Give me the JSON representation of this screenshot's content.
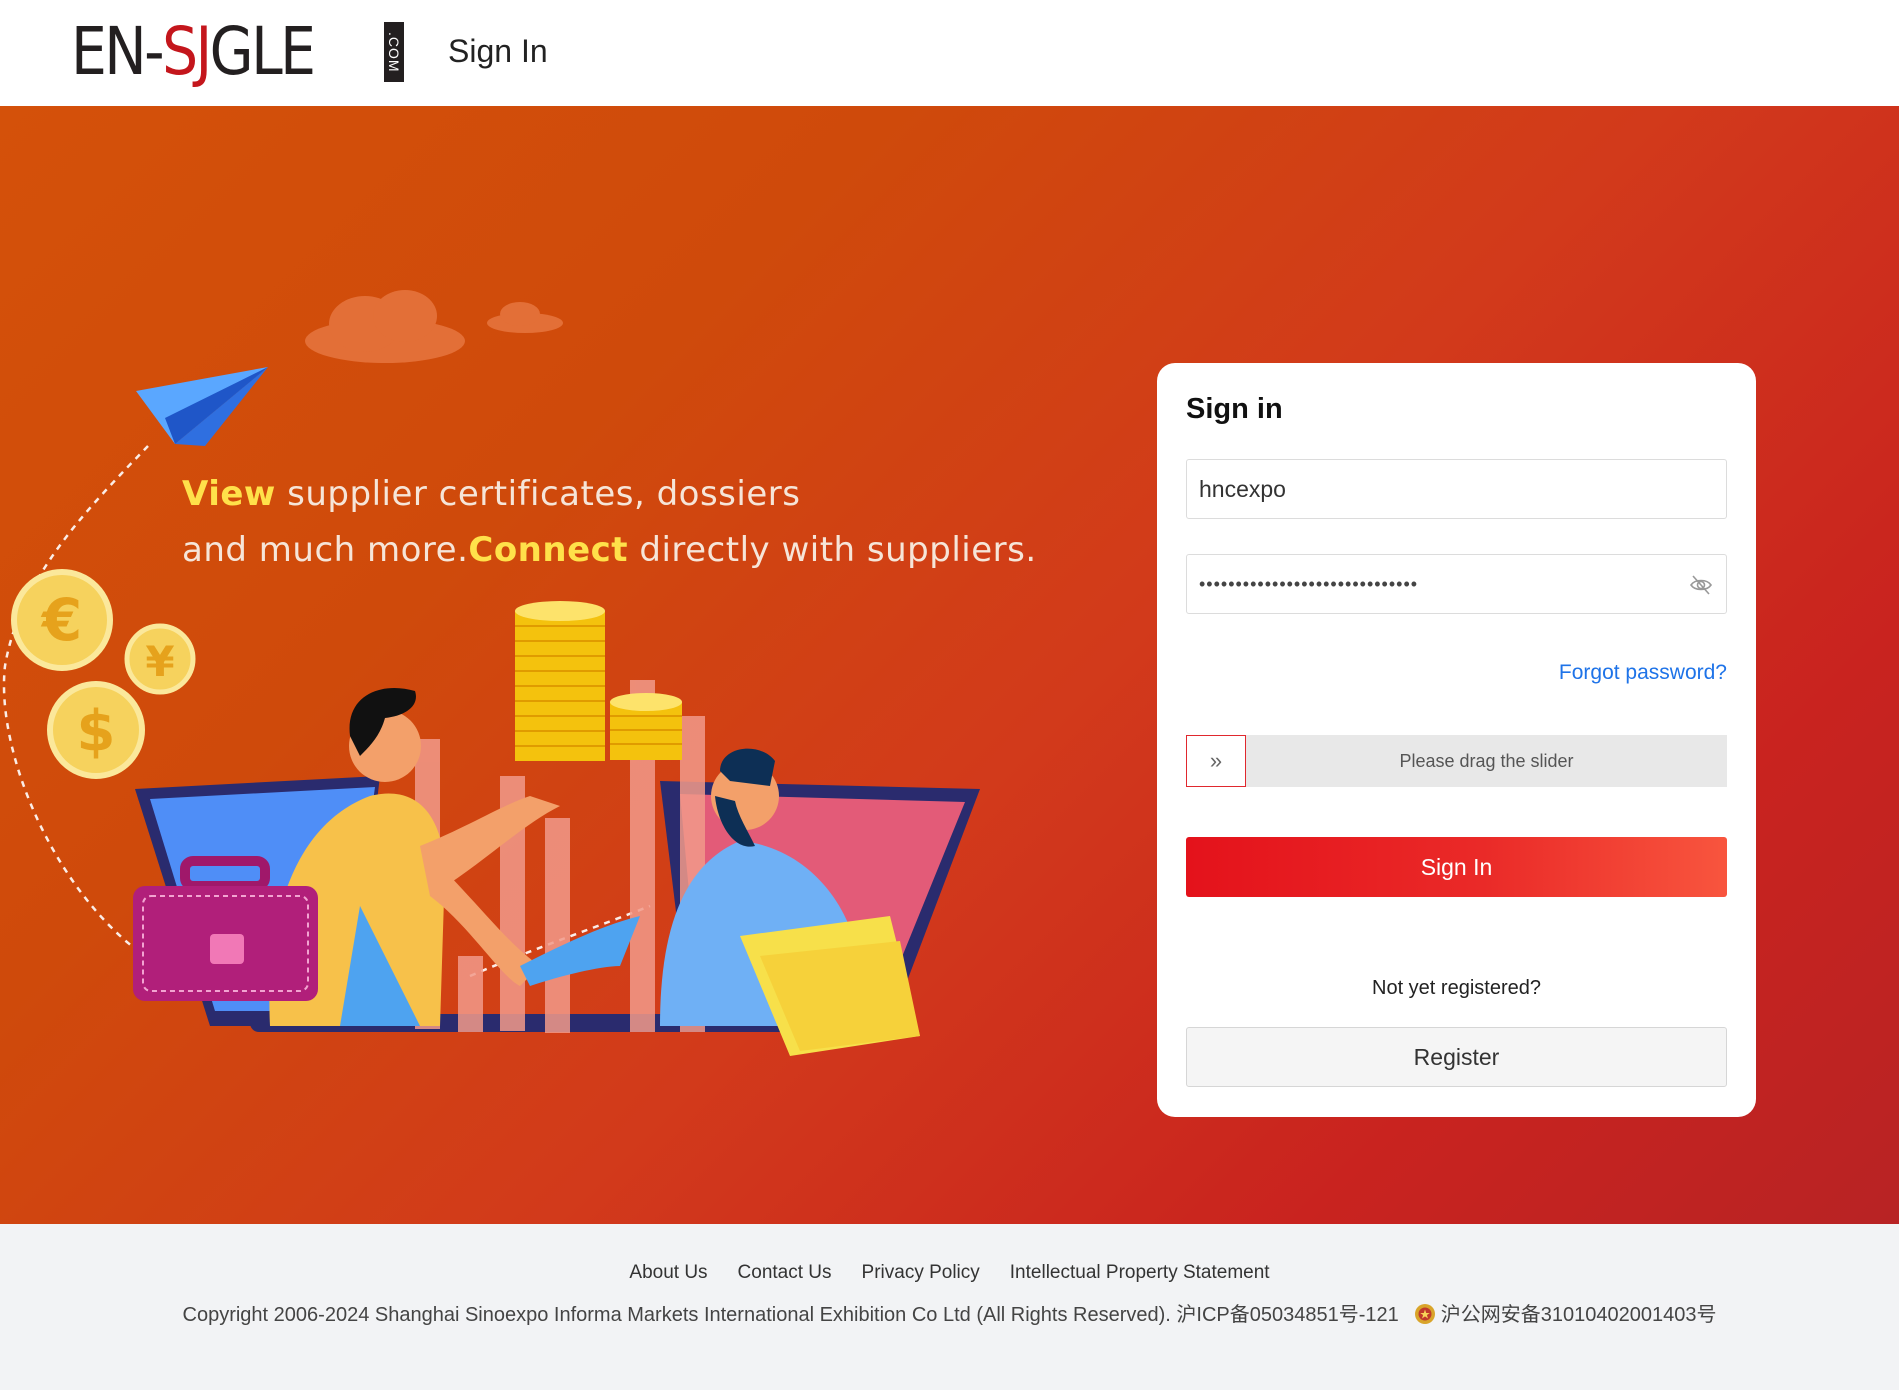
{
  "header": {
    "logo_main": "EN-",
    "logo_red": "SJ",
    "logo_end": "GLE",
    "logo_com": ".COM",
    "title": "Sign In"
  },
  "hero": {
    "line1_highlight": "View",
    "line1_rest": " supplier certificates, dossiers",
    "line2_start": "and much more.",
    "line2_highlight": "Connect",
    "line2_rest": " directly with suppliers."
  },
  "signin": {
    "title": "Sign in",
    "username_value": "hncexpo",
    "password_mask": "••••••••••••••••••••••••••••••",
    "forgot_label": "Forgot password?",
    "slider_text": "Please drag the slider",
    "slider_handle": "»",
    "signin_button": "Sign In",
    "not_registered": "Not yet registered?",
    "register_button": "Register"
  },
  "footer": {
    "links": [
      "About Us",
      "Contact Us",
      "Privacy Policy",
      "Intellectual Property Statement"
    ],
    "copyright": "Copyright 2006-2024 Shanghai Sinoexpo Informa Markets International Exhibition Co Ltd (All Rights Reserved). 沪ICP备05034851号-121",
    "police_record": "沪公网安备31010402001403号"
  },
  "colors": {
    "brand_red": "#c4161c",
    "link_blue": "#1e73e8",
    "button_red": "#e4121b",
    "highlight_yellow": "#ffe14a"
  }
}
